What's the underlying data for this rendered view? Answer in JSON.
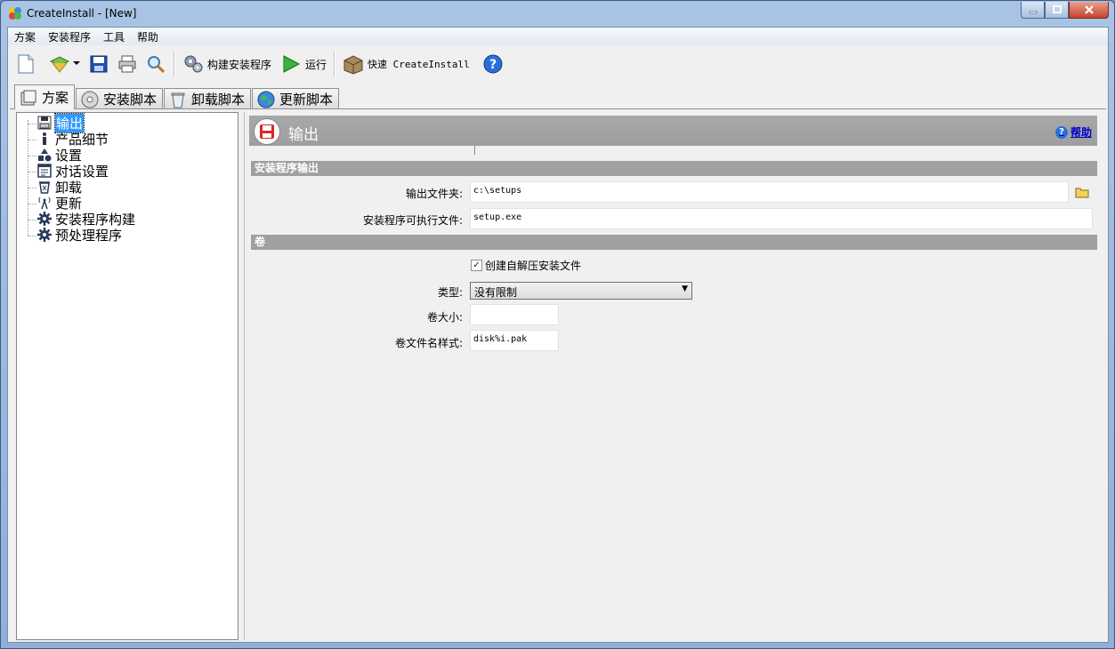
{
  "window": {
    "title": "CreateInstall - [New]"
  },
  "menu": [
    "方案",
    "安装程序",
    "工具",
    "帮助"
  ],
  "toolbar": {
    "build_label": "构建安装程序",
    "run_label": "运行",
    "quick_label": "快速 CreateInstall"
  },
  "tabs": [
    {
      "label": "方案",
      "active": true
    },
    {
      "label": "安装脚本"
    },
    {
      "label": "卸载脚本"
    },
    {
      "label": "更新脚本"
    }
  ],
  "tree": {
    "items": [
      {
        "label": "输出",
        "selected": true
      },
      {
        "label": "产品细节"
      },
      {
        "label": "设置"
      },
      {
        "label": "对话设置"
      },
      {
        "label": "卸载"
      },
      {
        "label": "更新"
      },
      {
        "label": "安装程序构建"
      },
      {
        "label": "预处理程序"
      }
    ]
  },
  "panel": {
    "title": "输出",
    "help_label": "帮助",
    "section_output": "安装程序输出",
    "output_folder_label": "输出文件夹:",
    "output_folder_value": "c:\\setups",
    "exe_label": "安装程序可执行文件:",
    "exe_value": "setup.exe",
    "section_volume": "卷",
    "sfx_label": "创建自解压安装文件",
    "sfx_checked": true,
    "type_label": "类型:",
    "type_value": "没有限制",
    "volume_size_label": "卷大小:",
    "volume_size_value": "",
    "volume_name_label": "卷文件名样式:",
    "volume_name_value": "disk%i.pak"
  }
}
